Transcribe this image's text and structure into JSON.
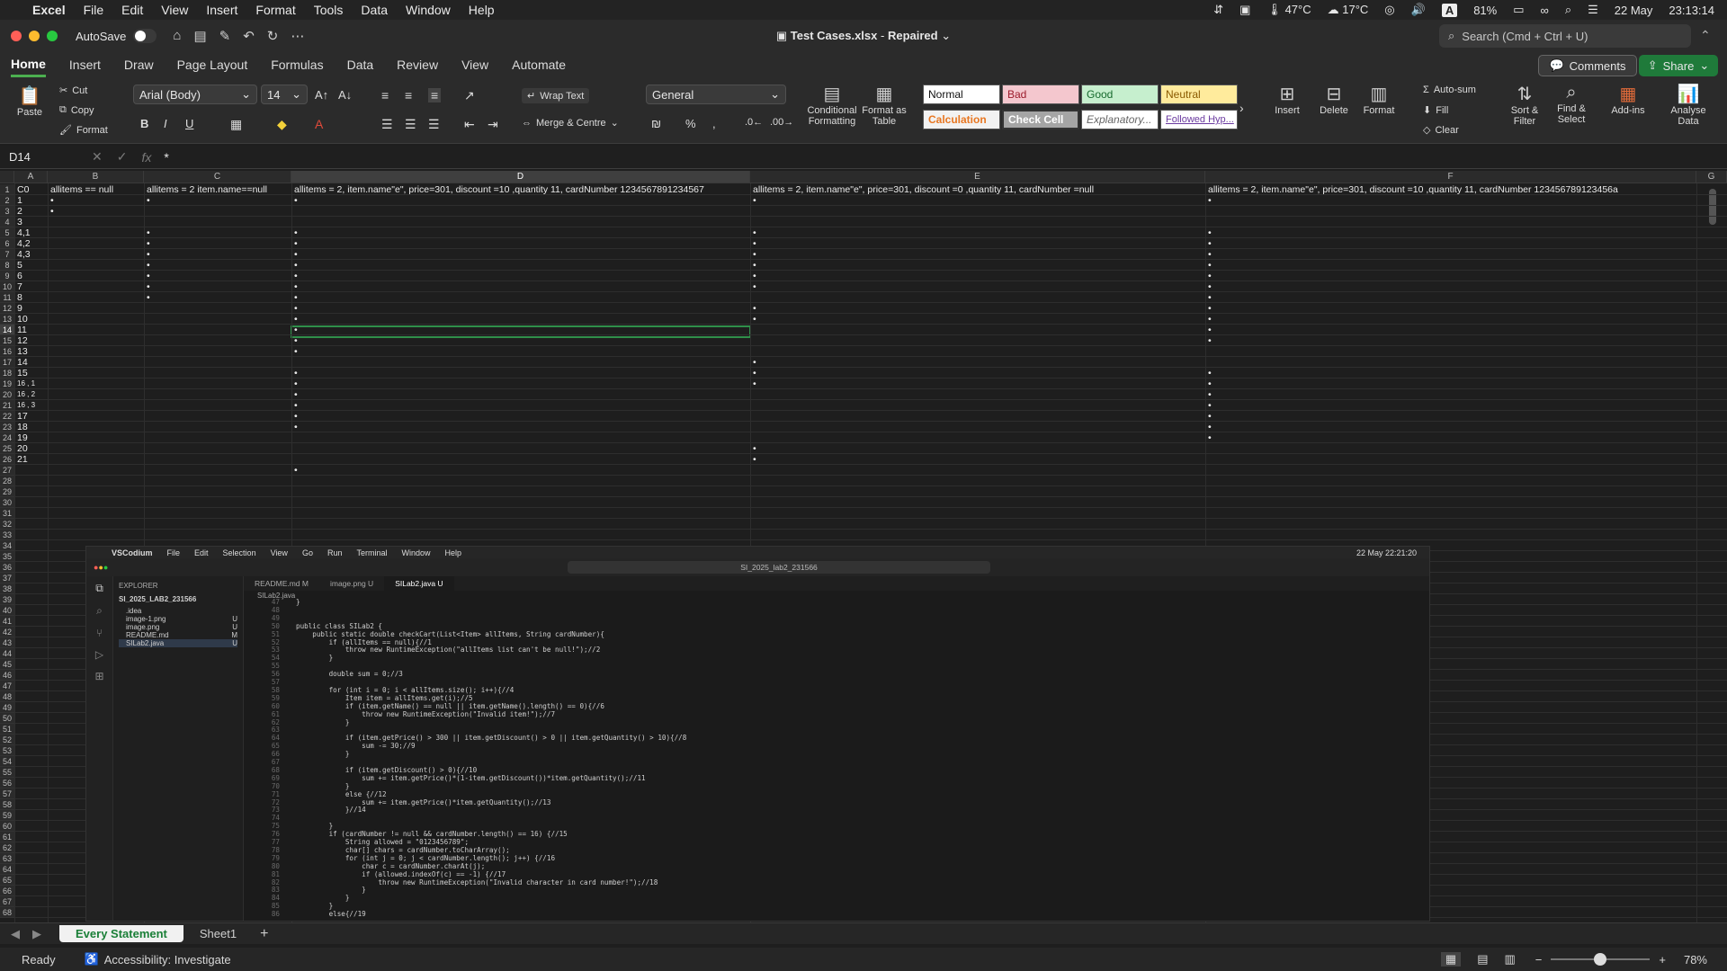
{
  "menubar": {
    "app": "Excel",
    "items": [
      "File",
      "Edit",
      "View",
      "Insert",
      "Format",
      "Tools",
      "Data",
      "Window",
      "Help"
    ],
    "status": {
      "temp1": "47°C",
      "temp2": "17°C",
      "battery": "81%",
      "date": "22 May",
      "time": "23:13:14"
    }
  },
  "titlebar": {
    "autosave": "AutoSave",
    "doc_name": "Test Cases.xlsx",
    "doc_state": "Repaired",
    "search_placeholder": "Search (Cmd + Ctrl + U)"
  },
  "tabs": [
    "Home",
    "Insert",
    "Draw",
    "Page Layout",
    "Formulas",
    "Data",
    "Review",
    "View",
    "Automate"
  ],
  "buttons": {
    "comments": "Comments",
    "share": "Share"
  },
  "ribbon": {
    "paste": "Paste",
    "cut": "Cut",
    "copy": "Copy",
    "format": "Format",
    "font": "Arial (Body)",
    "size": "14",
    "wrap": "Wrap Text",
    "merge": "Merge & Centre",
    "number_format": "General",
    "cond_fmt": "Conditional Formatting",
    "fmt_table": "Format as Table",
    "styles": [
      "Normal",
      "Bad",
      "Good",
      "Neutral",
      "Calculation",
      "Check Cell",
      "Explanatory...",
      "Followed Hyp..."
    ],
    "insert": "Insert",
    "delete": "Delete",
    "format_cells": "Format",
    "autosum": "Auto-sum",
    "fill": "Fill",
    "clear": "Clear",
    "sort": "Sort & Filter",
    "find": "Find & Select",
    "addins": "Add-ins",
    "analyse": "Analyse Data"
  },
  "formula_bar": {
    "cell_ref": "D14",
    "value": "*"
  },
  "columns": [
    "A",
    "B",
    "C",
    "D",
    "E",
    "F",
    "G"
  ],
  "headers": {
    "A1": "C0",
    "B1": "allitems == null",
    "C1": "allitems = 2 item.name==null",
    "D1": "allitems = 2, item.name\"e\", price=301, discount =10 ,quantity 11, cardNumber 1234567891234567",
    "E1": "allitems = 2, item.name\"e\", price=301, discount =0 ,quantity 11, cardNumber =null",
    "F1": "allitems = 2, item.name\"e\", price=301, discount =10 ,quantity 11, cardNumber 123456789123456a"
  },
  "col_a": [
    "1",
    "2",
    "3",
    "4,1",
    "4,2",
    "4,3",
    "5",
    "6",
    "7",
    "8",
    "9",
    "10",
    "11",
    "12",
    "13",
    "14",
    "15",
    "16 , 1",
    "16 , 2",
    "16 , 3",
    "17",
    "18",
    "19",
    "20",
    "21"
  ],
  "marks": {
    "B": [
      2,
      3
    ],
    "C": [
      2,
      5,
      6,
      7,
      8,
      9,
      10,
      11
    ],
    "D": [
      2,
      5,
      6,
      7,
      8,
      9,
      10,
      11,
      12,
      13,
      14,
      15,
      16,
      18,
      19,
      20,
      21,
      22,
      23,
      27
    ],
    "E": [
      2,
      5,
      6,
      7,
      8,
      9,
      10,
      12,
      13,
      17,
      18,
      19,
      25,
      26
    ],
    "F": [
      2,
      5,
      6,
      7,
      8,
      9,
      10,
      11,
      12,
      13,
      14,
      15,
      18,
      19,
      20,
      21,
      22,
      23,
      24
    ]
  },
  "mark_text": "•",
  "sheets": {
    "active": "Every Statement",
    "other": "Sheet1"
  },
  "status": {
    "ready": "Ready",
    "accessibility": "Accessibility: Investigate",
    "zoom": "78%"
  },
  "vscode": {
    "app": "VSCodium",
    "menu": [
      "File",
      "Edit",
      "Selection",
      "View",
      "Go",
      "Run",
      "Terminal",
      "Window",
      "Help"
    ],
    "clock": "22 May  22:21:20",
    "search": "SI_2025_lab2_231566",
    "explorer_title": "EXPLORER",
    "project": "SI_2025_LAB2_231566",
    "files": [
      ".idea",
      "image-1.png",
      "image.png",
      "README.md",
      "SILab2.java"
    ],
    "file_flags": [
      "",
      "U",
      "U",
      "M",
      "U"
    ],
    "tabs": [
      "README.md  M",
      "image.png  U",
      "SILab2.java  U"
    ],
    "breadcrumb": "SILab2.java",
    "lines": [
      {
        "n": "47",
        "t": "}"
      },
      {
        "n": "48",
        "t": ""
      },
      {
        "n": "49",
        "t": ""
      },
      {
        "n": "50",
        "t": "public class SILab2 {"
      },
      {
        "n": "51",
        "t": "    public static double checkCart(List<Item> allItems, String cardNumber){"
      },
      {
        "n": "52",
        "t": "        if (allItems == null){//1"
      },
      {
        "n": "53",
        "t": "            throw new RuntimeException(\"allItems list can't be null!\");//2"
      },
      {
        "n": "54",
        "t": "        }"
      },
      {
        "n": "55",
        "t": ""
      },
      {
        "n": "56",
        "t": "        double sum = 0;//3"
      },
      {
        "n": "57",
        "t": ""
      },
      {
        "n": "58",
        "t": "        for (int i = 0; i < allItems.size(); i++){//4"
      },
      {
        "n": "59",
        "t": "            Item item = allItems.get(i);//5"
      },
      {
        "n": "60",
        "t": "            if (item.getName() == null || item.getName().length() == 0){//6"
      },
      {
        "n": "61",
        "t": "                throw new RuntimeException(\"Invalid item!\");//7"
      },
      {
        "n": "62",
        "t": "            }"
      },
      {
        "n": "63",
        "t": ""
      },
      {
        "n": "64",
        "t": "            if (item.getPrice() > 300 || item.getDiscount() > 0 || item.getQuantity() > 10){//8"
      },
      {
        "n": "65",
        "t": "                sum -= 30;//9"
      },
      {
        "n": "66",
        "t": "            }"
      },
      {
        "n": "67",
        "t": ""
      },
      {
        "n": "68",
        "t": "            if (item.getDiscount() > 0){//10"
      },
      {
        "n": "69",
        "t": "                sum += item.getPrice()*(1-item.getDiscount())*item.getQuantity();//11"
      },
      {
        "n": "70",
        "t": "            }"
      },
      {
        "n": "71",
        "t": "            else {//12"
      },
      {
        "n": "72",
        "t": "                sum += item.getPrice()*item.getQuantity();//13"
      },
      {
        "n": "73",
        "t": "            }//14"
      },
      {
        "n": "74",
        "t": ""
      },
      {
        "n": "75",
        "t": "        }"
      },
      {
        "n": "76",
        "t": "        if (cardNumber != null && cardNumber.length() == 16) {//15"
      },
      {
        "n": "77",
        "t": "            String allowed = \"0123456789\";"
      },
      {
        "n": "78",
        "t": "            char[] chars = cardNumber.toCharArray();"
      },
      {
        "n": "79",
        "t": "            for (int j = 0; j < cardNumber.length(); j++) {//16"
      },
      {
        "n": "80",
        "t": "                char c = cardNumber.charAt(j);"
      },
      {
        "n": "81",
        "t": "                if (allowed.indexOf(c) == -1) {//17"
      },
      {
        "n": "82",
        "t": "                    throw new RuntimeException(\"Invalid character in card number!\");//18"
      },
      {
        "n": "83",
        "t": "                }"
      },
      {
        "n": "84",
        "t": "            }"
      },
      {
        "n": "85",
        "t": "        }"
      },
      {
        "n": "86",
        "t": "        else{//19"
      }
    ]
  },
  "colors": {
    "accent": "#4caf50",
    "selection": "#2f8f4a",
    "share": "#1f7a3a",
    "bad_bg": "#f4c7ce",
    "good_bg": "#c6efce",
    "neutral_bg": "#ffeb9c"
  }
}
